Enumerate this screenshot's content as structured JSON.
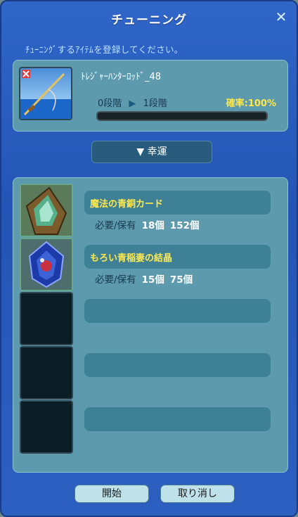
{
  "window": {
    "title": "チューニング",
    "instruction": "ﾁｭｰﾆﾝｸﾞするｱｲﾃﾑを登録してください。"
  },
  "target": {
    "name": "ﾄﾚｼﾞｬｰﾊﾝﾀｰﾛｯﾄﾞ_48",
    "stage_from": "0段階",
    "stage_arrow": "▶",
    "stage_to": "1段階",
    "rate": "確率:100%"
  },
  "luck_button": "▼ 幸運",
  "materials": [
    {
      "name": "魔法の青銅カード",
      "required_label": "必要/保有",
      "required": "18個",
      "owned": "152個",
      "icon": "bronze-card-icon"
    },
    {
      "name": "もろい青稲妻の結晶",
      "required_label": "必要/保有",
      "required": "15個",
      "owned": "75個",
      "icon": "blue-lightning-crystal-icon"
    }
  ],
  "buttons": {
    "start": "開始",
    "cancel": "取り消し"
  },
  "colors": {
    "window": "#2455b4",
    "panel": "#5d9aae",
    "accent_yellow": "#ffe84a",
    "row": "#3e8196"
  }
}
